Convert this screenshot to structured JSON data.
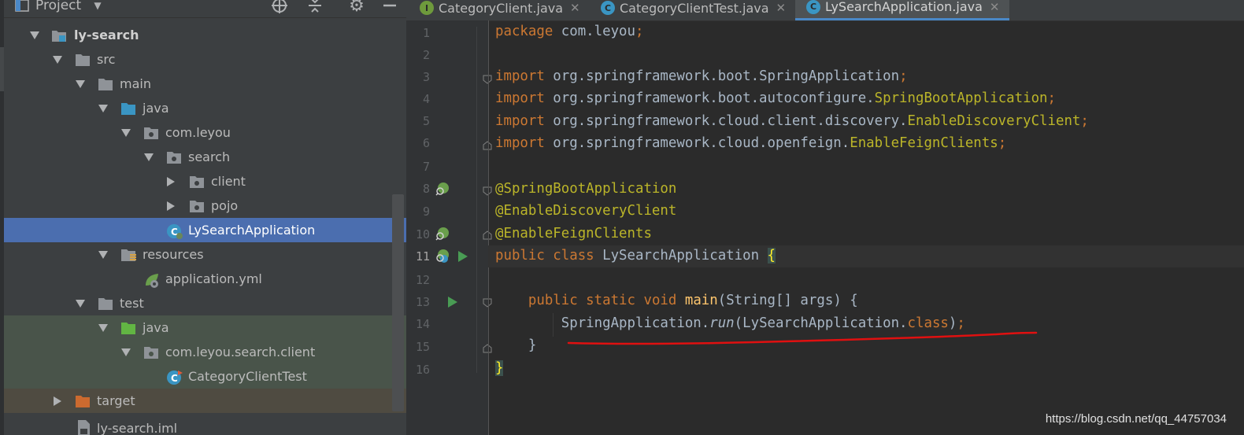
{
  "project_panel": {
    "title": "Project",
    "tree": [
      {
        "label": "ly-search",
        "bold": true
      },
      {
        "label": "src"
      },
      {
        "label": "main"
      },
      {
        "label": "java"
      },
      {
        "label": "com.leyou"
      },
      {
        "label": "search"
      },
      {
        "label": "client"
      },
      {
        "label": "pojo"
      },
      {
        "label": "LySearchApplication",
        "selected": true
      },
      {
        "label": "resources"
      },
      {
        "label": "application.yml"
      },
      {
        "label": "test"
      },
      {
        "label": "java"
      },
      {
        "label": "com.leyou.search.client"
      },
      {
        "label": "CategoryClientTest"
      },
      {
        "label": "target"
      },
      {
        "label": "ly-search.iml"
      }
    ]
  },
  "editor": {
    "tabs": [
      {
        "icon_letter": "I",
        "label": "CategoryClient.java",
        "close": "✕",
        "icon_color": "#6e9a3c"
      },
      {
        "icon_letter": "C",
        "label": "CategoryClientTest.java",
        "close": "✕",
        "icon_color": "#3a95c3"
      },
      {
        "icon_letter": "C",
        "label": "LySearchApplication.java",
        "close": "✕",
        "icon_color": "#3a95c3",
        "active": true
      }
    ],
    "line_numbers": [
      "1",
      "2",
      "3",
      "4",
      "5",
      "6",
      "7",
      "8",
      "9",
      "10",
      "11",
      "12",
      "13",
      "14",
      "15",
      "16"
    ],
    "current_line": "11",
    "code": {
      "l1_kw": "package",
      "l1_rest": " com.leyou",
      "l1_semi": ";",
      "imp_kw": "import",
      "l3_pkg": " org.springframework.boot.",
      "l3_cls": "SpringApplication",
      "l4_pkg": " org.springframework.boot.autoconfigure.",
      "l4_cls": "SpringBootApplication",
      "l5_pkg": " org.springframework.cloud.client.discovery.",
      "l5_cls": "EnableDiscoveryClient",
      "l6_pkg": " org.springframework.cloud.openfeign.",
      "l6_cls": "EnableFeignClients",
      "semi": ";",
      "l8": "@SpringBootApplication",
      "l9": "@EnableDiscoveryClient",
      "l10": "@EnableFeignClients",
      "l11_kw": "public class",
      "l11_name": " LySearchApplication ",
      "l11_brace": "{",
      "l13_indent": "    ",
      "l13_kw": "public static void",
      "l13_sp": " ",
      "l13_fn": "main",
      "l13_rest": "(String[] args) {",
      "l14_indent": "        ",
      "l14_a": "SpringApplication.",
      "l14_run": "run",
      "l14_b": "(LySearchApplication.",
      "l14_class": "class",
      "l14_c": ")",
      "l14_semi": ";",
      "l15": "    }",
      "l16_brace": "}"
    }
  },
  "watermark": "https://blog.csdn.net/qq_44757034",
  "colors": {
    "keyword": "#cc7832",
    "annotation": "#bbb529",
    "function": "#ffc66d",
    "selection": "#4b6eaf",
    "annotation_underline": "#e01010"
  }
}
